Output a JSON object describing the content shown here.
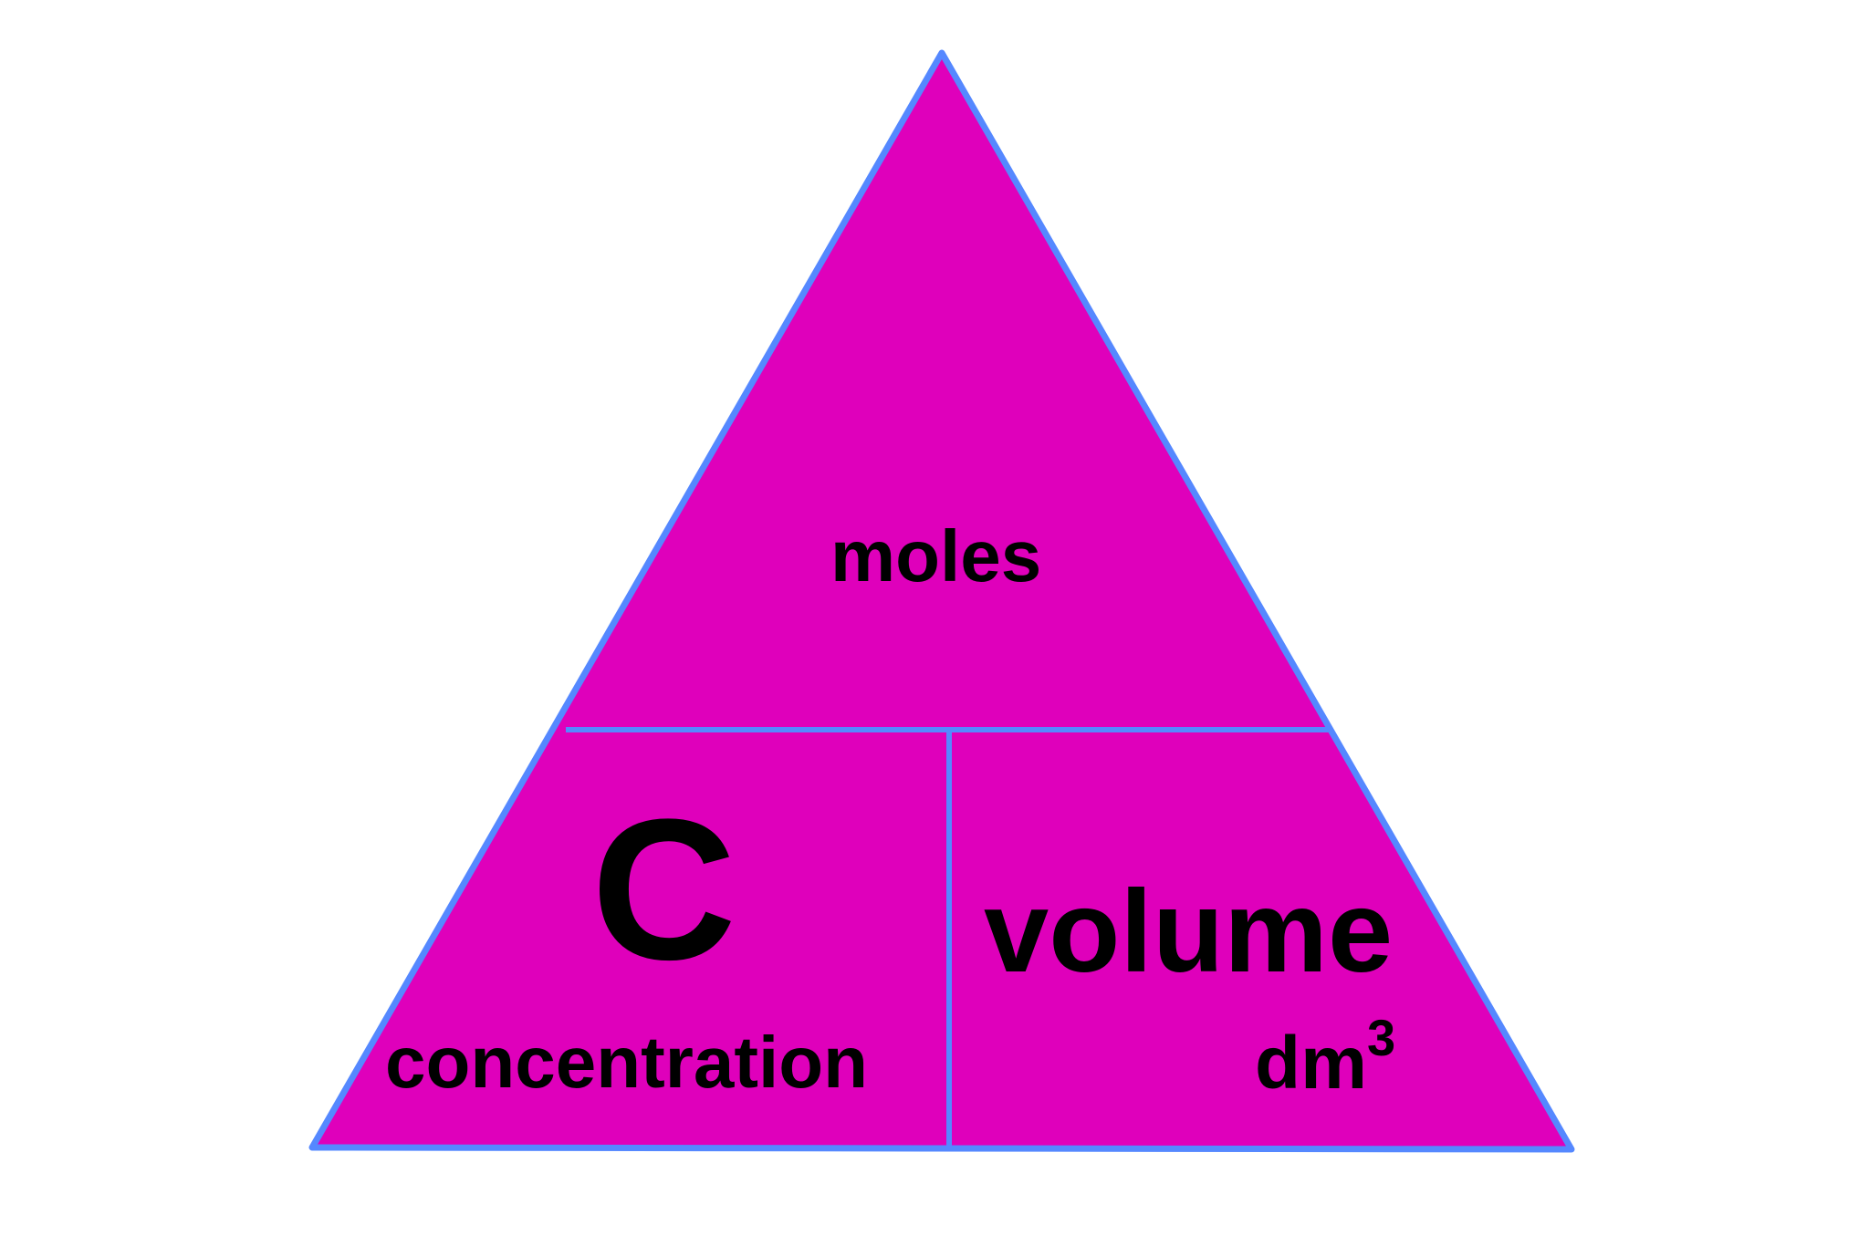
{
  "diagram": {
    "colors": {
      "fill": "#df00bb",
      "outline": "#5588ff",
      "text": "#000000",
      "background": "#ffffff"
    },
    "top_section": {
      "label": "moles"
    },
    "bottom_left_section": {
      "symbol": "C",
      "label": "concentration"
    },
    "bottom_right_section": {
      "label": "volume",
      "unit_base": "dm",
      "unit_exponent": "3"
    }
  }
}
